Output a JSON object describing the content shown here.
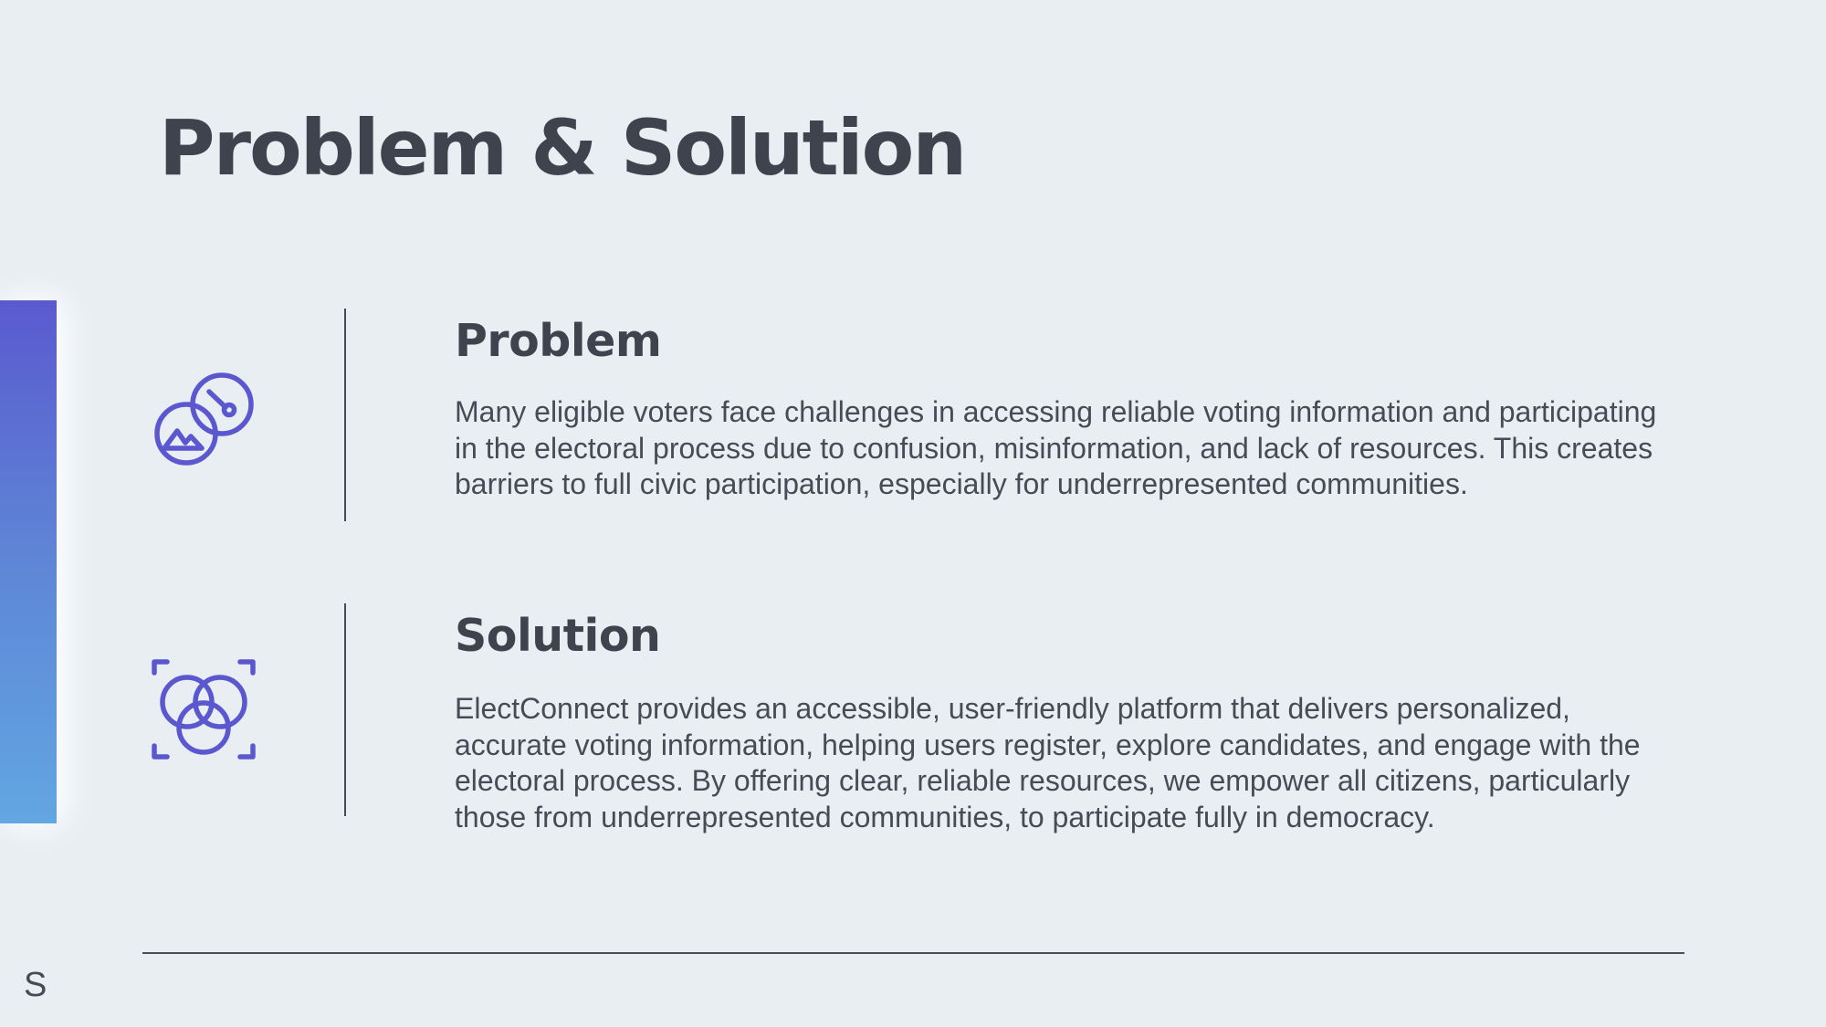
{
  "slide": {
    "title": "Problem & Solution",
    "accent_gradient": [
      "#5a5acf",
      "#62a6e2"
    ],
    "icon_color": "#5b57cf"
  },
  "sections": [
    {
      "heading": "Problem",
      "icon": "linked-discs-mountain-icon",
      "body": "Many eligible voters face challenges in accessing reliable voting information and participating in the electoral process due to confusion, misinformation, and lack of resources. This creates barriers to full civic participation, especially for underrepresented communities."
    },
    {
      "heading": "Solution",
      "icon": "venn-circles-frame-icon",
      "body": "ElectConnect provides an accessible, user-friendly platform that delivers personalized, accurate voting information, helping users register, explore candidates, and engage with the electoral process. By offering clear, reliable resources, we empower all citizens, particularly those from underrepresented communities, to participate fully in democracy."
    }
  ],
  "footer": {
    "mark": "S"
  }
}
